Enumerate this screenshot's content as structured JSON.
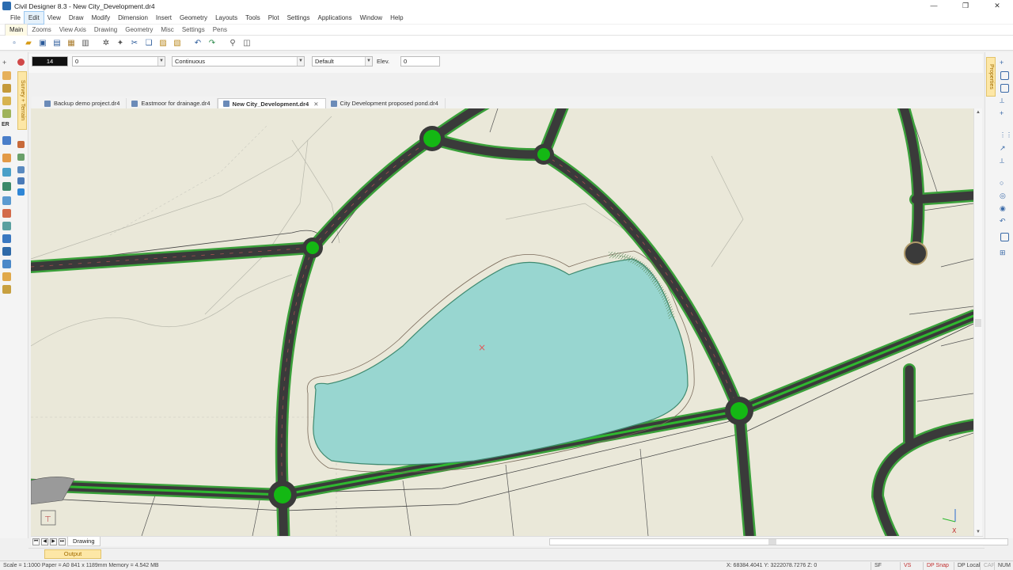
{
  "window": {
    "title": "Civil Designer 8.3 - New City_Development.dr4",
    "controls": [
      "—",
      "❐",
      "✕"
    ]
  },
  "menu": [
    "File",
    "Edit",
    "View",
    "Draw",
    "Modify",
    "Dimension",
    "Insert",
    "Geometry",
    "Layouts",
    "Tools",
    "Plot",
    "Settings",
    "Applications",
    "Window",
    "Help"
  ],
  "ribbon_tabs": [
    "Main",
    "Zooms",
    "View Axis",
    "Drawing",
    "Geometry",
    "Misc",
    "Settings",
    "Pens"
  ],
  "properties": {
    "color_value": "14",
    "layer_value": "0",
    "linetype_value": "Continuous",
    "pen_value": "Default",
    "elev_label": "Elev.",
    "elev_value": "0"
  },
  "side_tabs": {
    "left": "Survey + Terrain",
    "right": "Properties"
  },
  "doc_tabs": [
    {
      "label": "Backup demo project.dr4",
      "active": false
    },
    {
      "label": "Eastmoor for drainage.dr4",
      "active": false
    },
    {
      "label": "New City_Development.dr4",
      "active": true
    },
    {
      "label": "City Development proposed pond.dr4",
      "active": false
    }
  ],
  "sheet_tab": "Drawing",
  "output_tab": "Output",
  "status": {
    "left": "Scale = 1:1000  Paper = A0 841 x 1189mm  Memory = 4.542 MB",
    "coords": "X: 68384.4041 Y: 3222078.7276 Z: 0",
    "indicators": [
      "SF",
      "VS",
      "DP Snap",
      "DP Local",
      "CAP",
      "NUM"
    ]
  },
  "colors": {
    "road": "#3a3a3a",
    "verge": "#2e9a2e",
    "roundabout": "#14b814",
    "pond": "#98d6d0",
    "ground": "#eae8d9",
    "accent": "#fde7a6"
  }
}
